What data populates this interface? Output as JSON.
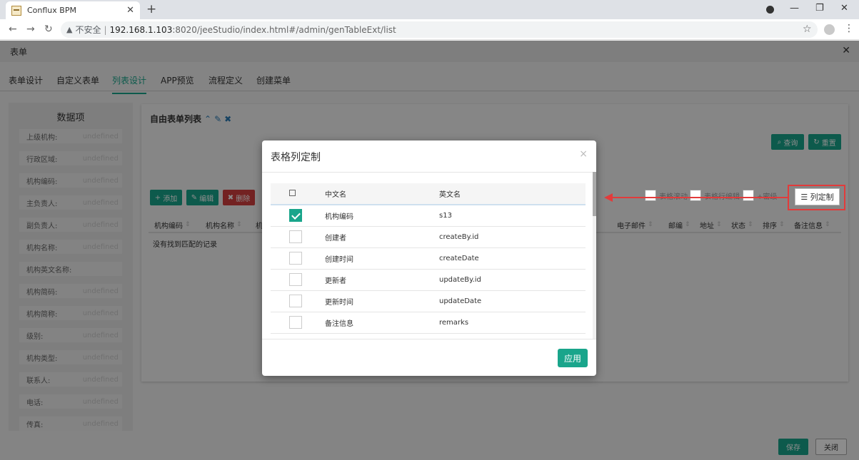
{
  "browser": {
    "tab_title": "Conflux BPM",
    "insecure_label": "不安全",
    "separator": "|",
    "host": "192.168.1.103",
    "path": ":8020/jeeStudio/index.html#/admin/genTableExt/list"
  },
  "app": {
    "header_title": "表单",
    "tabs": [
      {
        "label": "表单设计"
      },
      {
        "label": "自定义表单"
      },
      {
        "label": "列表设计"
      },
      {
        "label": "APP预览"
      },
      {
        "label": "流程定义"
      },
      {
        "label": "创建菜单"
      }
    ],
    "sidebar": {
      "title": "数据项",
      "fields": [
        {
          "key": "上级机构:",
          "value": "undefined"
        },
        {
          "key": "行政区域:",
          "value": "undefined"
        },
        {
          "key": "机构编码:",
          "value": "undefined"
        },
        {
          "key": "主负责人:",
          "value": "undefined"
        },
        {
          "key": "副负责人:",
          "value": "undefined"
        },
        {
          "key": "机构名称:",
          "value": "undefined"
        },
        {
          "key": "机构英文名称:",
          "value": ""
        },
        {
          "key": "机构简码:",
          "value": "undefined"
        },
        {
          "key": "机构简称:",
          "value": "undefined"
        },
        {
          "key": "级别:",
          "value": "undefined"
        },
        {
          "key": "机构类型:",
          "value": "undefined"
        },
        {
          "key": "联系人:",
          "value": "undefined"
        },
        {
          "key": "电话:",
          "value": "undefined"
        },
        {
          "key": "传真:",
          "value": "undefined"
        }
      ]
    },
    "panel": {
      "title": "自由表单列表",
      "query_label": "查询",
      "reset_label": "重置",
      "add_label": "添加",
      "edit_label": "编辑",
      "delete_label": "删除",
      "ctl_scroll": "表格滚动",
      "ctl_inline_edit": "表格行编辑",
      "ctl_dense": "+密级",
      "col_custom_label": "列定制",
      "left_columns": [
        "机构编码",
        "机构名称",
        "机"
      ],
      "right_columns": [
        "电子邮件",
        "邮编",
        "地址",
        "状态",
        "排序",
        "备注信息"
      ],
      "empty_text": "没有找到匹配的记录"
    },
    "footer": {
      "save_label": "保存",
      "close_label": "关闭"
    }
  },
  "modal": {
    "title": "表格列定制",
    "close": "×",
    "header": {
      "cn": "中文名",
      "en": "英文名"
    },
    "rows": [
      {
        "cn": "机构编码",
        "en": "s13",
        "checked": true
      },
      {
        "cn": "创建者",
        "en": "createBy.id",
        "checked": false
      },
      {
        "cn": "创建时间",
        "en": "createDate",
        "checked": false
      },
      {
        "cn": "更新者",
        "en": "updateBy.id",
        "checked": false
      },
      {
        "cn": "更新时间",
        "en": "updateDate",
        "checked": false
      },
      {
        "cn": "备注信息",
        "en": "remarks",
        "checked": false
      }
    ],
    "apply_label": "应用"
  }
}
